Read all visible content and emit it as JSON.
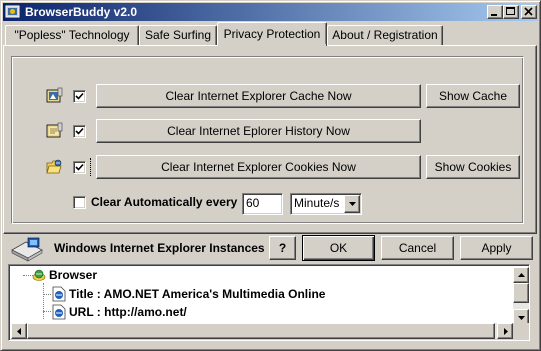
{
  "window": {
    "title": "BrowserBuddy v2.0"
  },
  "tabs": [
    {
      "label": "\"Popless\" Technology"
    },
    {
      "label": "Safe Surfing"
    },
    {
      "label": "Privacy Protection"
    },
    {
      "label": "About / Registration"
    }
  ],
  "privacy": {
    "cache_button": "Clear Internet Explorer Cache Now",
    "show_cache": "Show Cache",
    "history_button": "Clear Internet Eplorer History Now",
    "cookies_button": "Clear Internet Explorer Cookies Now",
    "show_cookies": "Show Cookies",
    "auto_label": "Clear Automatically every",
    "auto_value": "60",
    "unit_value": "Minute/s"
  },
  "bottom": {
    "instances_label": "Windows Internet Explorer Instances",
    "help": "?",
    "ok": "OK",
    "cancel": "Cancel",
    "apply": "Apply"
  },
  "tree": {
    "root": "Browser",
    "children": [
      "Title : AMO.NET America's Multimedia Online",
      "URL : http://amo.net/"
    ]
  }
}
